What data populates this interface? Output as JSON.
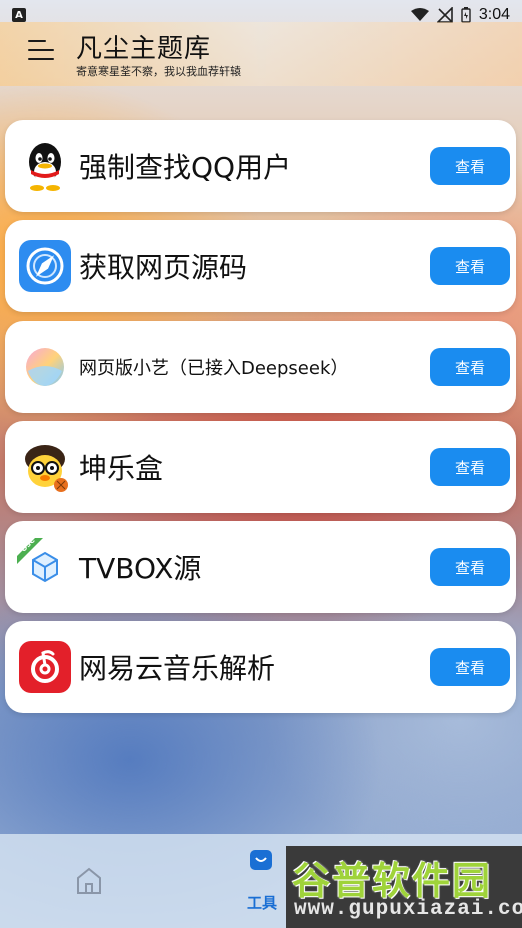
{
  "status_bar": {
    "left_badge": "A",
    "time": "3:04"
  },
  "header": {
    "title": "凡尘主题库",
    "subtitle": "寄意寒星荃不察，我以我血荐轩辕"
  },
  "cards": [
    {
      "label": "强制查找QQ用户",
      "button": "查看",
      "icon": "qq-penguin-icon"
    },
    {
      "label": "获取网页源码",
      "button": "查看",
      "icon": "browser-compass-icon"
    },
    {
      "label": "网页版小艺（已接入Deepseek）",
      "button": "查看",
      "icon": "xiaoyi-orb-icon"
    },
    {
      "label": "坤乐盒",
      "button": "查看",
      "icon": "cartoon-chick-icon"
    },
    {
      "label": "TVBOX源",
      "button": "查看",
      "icon": "tvbox-cube-icon",
      "badge": "OSC"
    },
    {
      "label": "网易云音乐解析",
      "button": "查看",
      "icon": "netease-music-icon"
    }
  ],
  "bottom_nav": {
    "tools_label": "工具"
  },
  "watermark": {
    "line1": "谷普软件园",
    "line2": "www.gupuxiazai.com"
  },
  "colors": {
    "accent": "#1a8cf0",
    "nav_active": "#1a6fd4"
  }
}
